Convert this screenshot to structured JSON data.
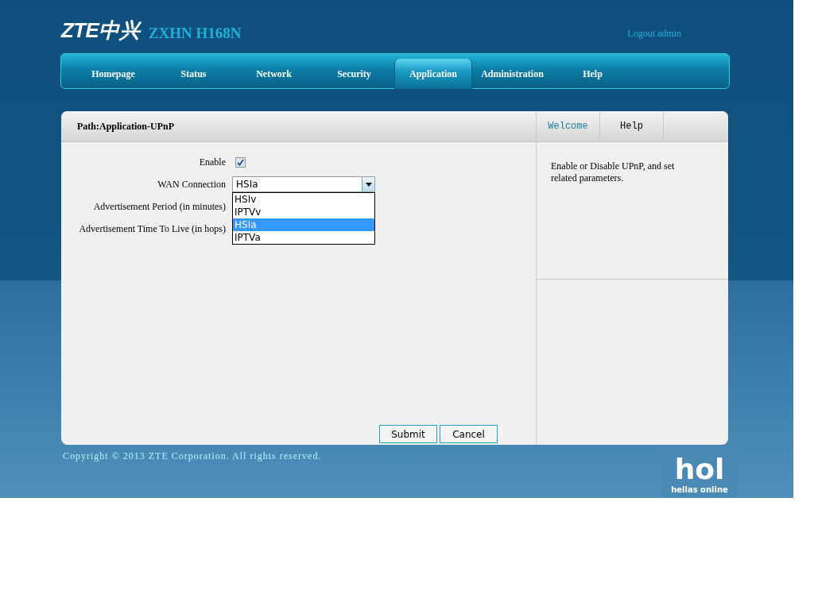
{
  "header": {
    "brand": "ZTE中兴",
    "model": "ZXHN H168N",
    "logout": "Logout admin"
  },
  "nav": [
    {
      "label": "Homepage",
      "selected": false
    },
    {
      "label": "Status",
      "selected": false
    },
    {
      "label": "Network",
      "selected": false
    },
    {
      "label": "Security",
      "selected": false
    },
    {
      "label": "Application",
      "selected": true
    },
    {
      "label": "Administration",
      "selected": false
    },
    {
      "label": "Help",
      "selected": false
    }
  ],
  "path": "Path:Application-UPnP",
  "form": {
    "enable": {
      "label": "Enable",
      "checked": true
    },
    "wan": {
      "label": "WAN Connection",
      "value": "HSIa",
      "options": [
        {
          "label": "HSIv",
          "selected": false
        },
        {
          "label": "IPTVv",
          "selected": false
        },
        {
          "label": "HSIa",
          "selected": true
        },
        {
          "label": "IPTVa",
          "selected": false
        }
      ]
    },
    "labels": [
      "Advertisement Period (in minutes)",
      "Advertisement Time To Live (in hops)"
    ]
  },
  "buttons": [
    "Submit",
    "Cancel"
  ],
  "side_tabs": [
    {
      "label": "Welcome",
      "selected": true
    },
    {
      "label": "Help",
      "selected": false
    }
  ],
  "help_text": "Enable or Disable UPnP, and set related parameters.",
  "copyright": "Copyright © 2013 ZTE Corporation. All rights reserved.",
  "corner_logo": {
    "mark": "hol",
    "tagline": "hellas online"
  }
}
